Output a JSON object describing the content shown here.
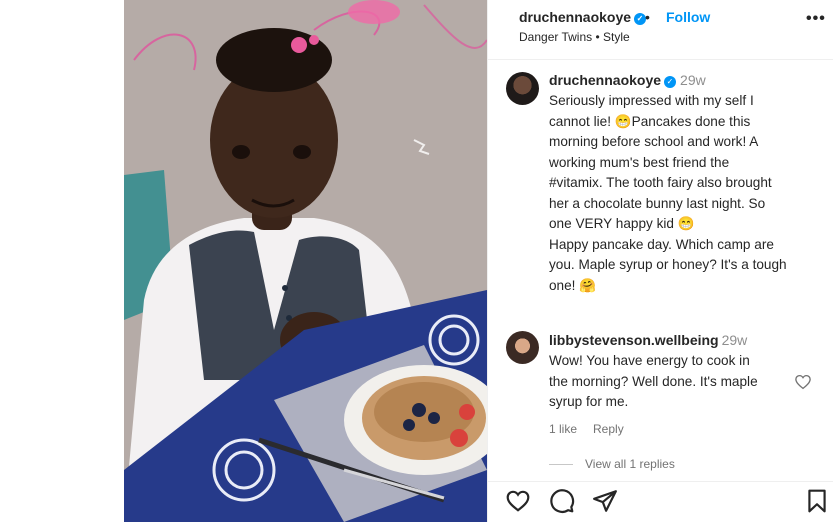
{
  "post": {
    "author": "druchennaokoye",
    "follow_label": "Follow",
    "separator": "•",
    "subtitle": "Danger Twins • Style",
    "more_label": "•••"
  },
  "caption": {
    "author": "druchennaokoye",
    "time": "29w",
    "lines": [
      "Seriously impressed with my self I",
      "cannot lie! 😁Pancakes done this",
      "morning before school and work! A",
      "working mum's best friend the",
      "#vitamix. The tooth fairy also brought",
      "her a chocolate bunny last night. So",
      "one VERY happy kid 😁",
      "Happy pancake day. Which camp are",
      "you. Maple syrup or honey? It's a tough",
      "one! 🤗"
    ]
  },
  "reply": {
    "author": "libbystevenson.wellbeing",
    "time": "29w",
    "lines": [
      "Wow! You have energy to cook in",
      "the morning? Well done. It's maple",
      "syrup for me."
    ],
    "likes": "1 like",
    "reply_label": "Reply",
    "view_replies": "View all 1 replies"
  },
  "icons": {
    "verified": "verified-badge-icon",
    "like": "heart-icon",
    "comment": "comment-bubble-icon",
    "share": "paper-plane-icon",
    "save": "bookmark-icon",
    "comment_like": "heart-outline-icon"
  },
  "colors": {
    "accent": "#0095f6",
    "text": "#262626",
    "muted": "#737373",
    "border": "#efefef"
  }
}
